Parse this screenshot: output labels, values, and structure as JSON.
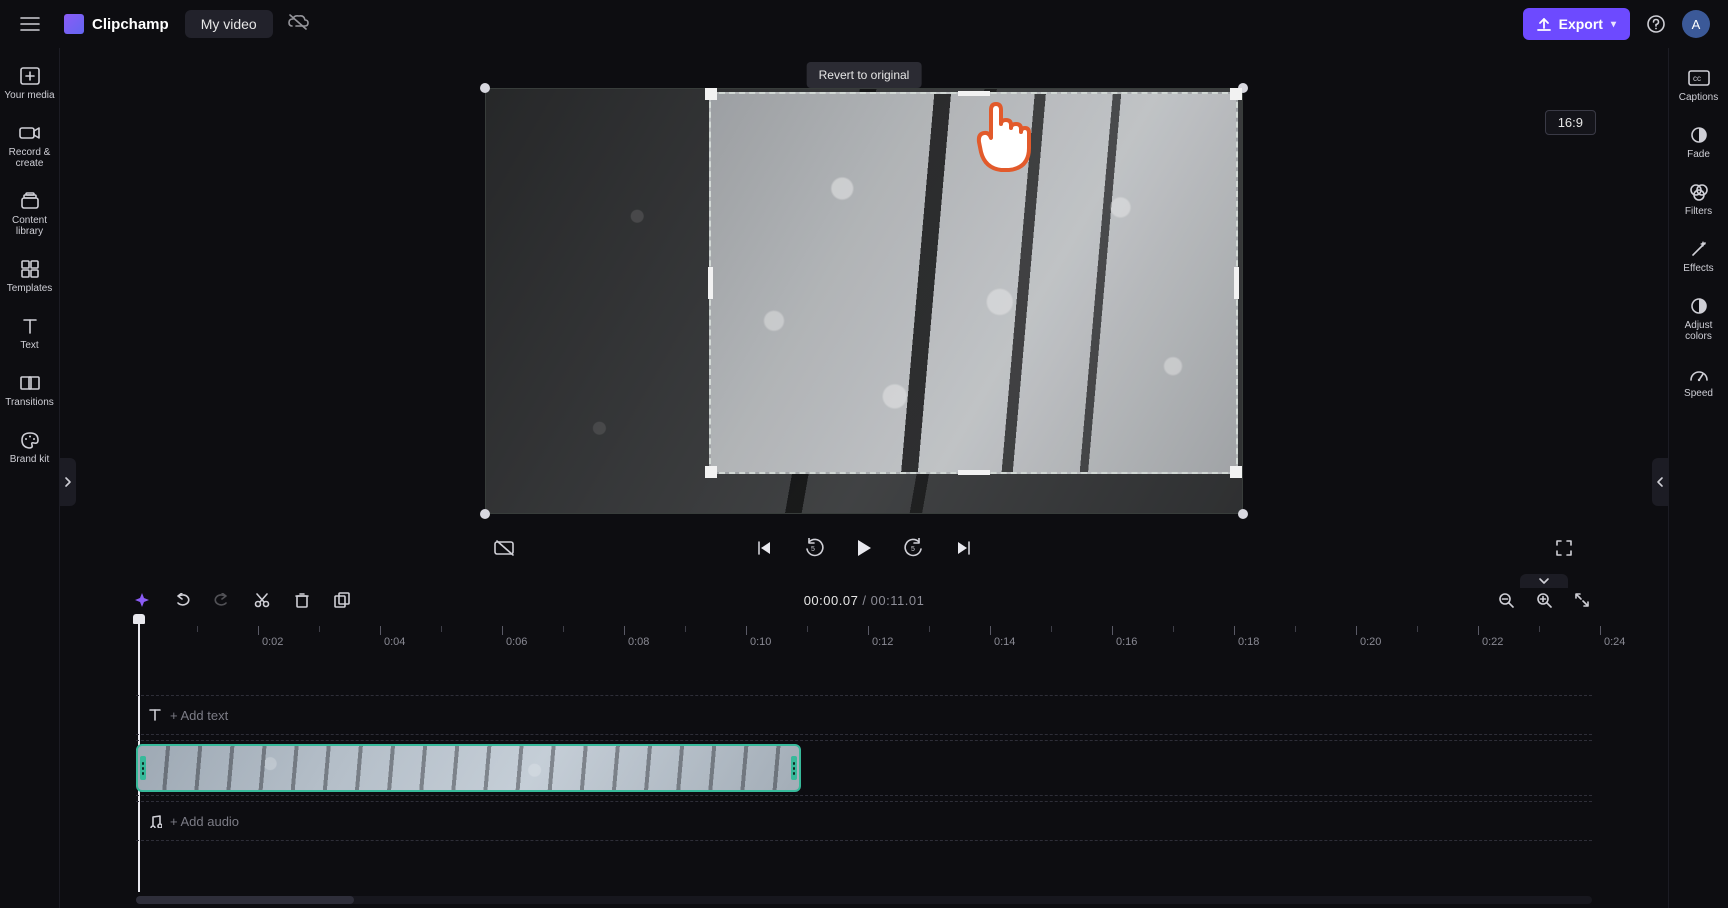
{
  "app": {
    "name": "Clipchamp"
  },
  "header": {
    "title": "My video",
    "export_label": "Export",
    "avatar_letter": "A"
  },
  "left_rail": [
    {
      "id": "your-media",
      "label": "Your media"
    },
    {
      "id": "record-create",
      "label": "Record &\ncreate"
    },
    {
      "id": "content-library",
      "label": "Content\nlibrary"
    },
    {
      "id": "templates",
      "label": "Templates"
    },
    {
      "id": "text",
      "label": "Text"
    },
    {
      "id": "transitions",
      "label": "Transitions"
    },
    {
      "id": "brand-kit",
      "label": "Brand kit"
    }
  ],
  "right_rail": [
    {
      "id": "captions",
      "label": "Captions"
    },
    {
      "id": "fade",
      "label": "Fade"
    },
    {
      "id": "filters",
      "label": "Filters"
    },
    {
      "id": "effects",
      "label": "Effects"
    },
    {
      "id": "adjust-colors",
      "label": "Adjust\ncolors"
    },
    {
      "id": "speed",
      "label": "Speed"
    }
  ],
  "preview": {
    "tooltip": "Revert to original",
    "aspect_label": "16:9"
  },
  "time": {
    "current": "00:00.07",
    "duration": "00:11.01"
  },
  "ruler": {
    "labels": [
      "0:02",
      "0:04",
      "0:06",
      "0:08",
      "0:10",
      "0:12",
      "0:14",
      "0:16",
      "0:18",
      "0:20",
      "0:22",
      "0:24"
    ]
  },
  "tracks": {
    "text_placeholder": "+ Add text",
    "audio_placeholder": "+ Add audio"
  }
}
